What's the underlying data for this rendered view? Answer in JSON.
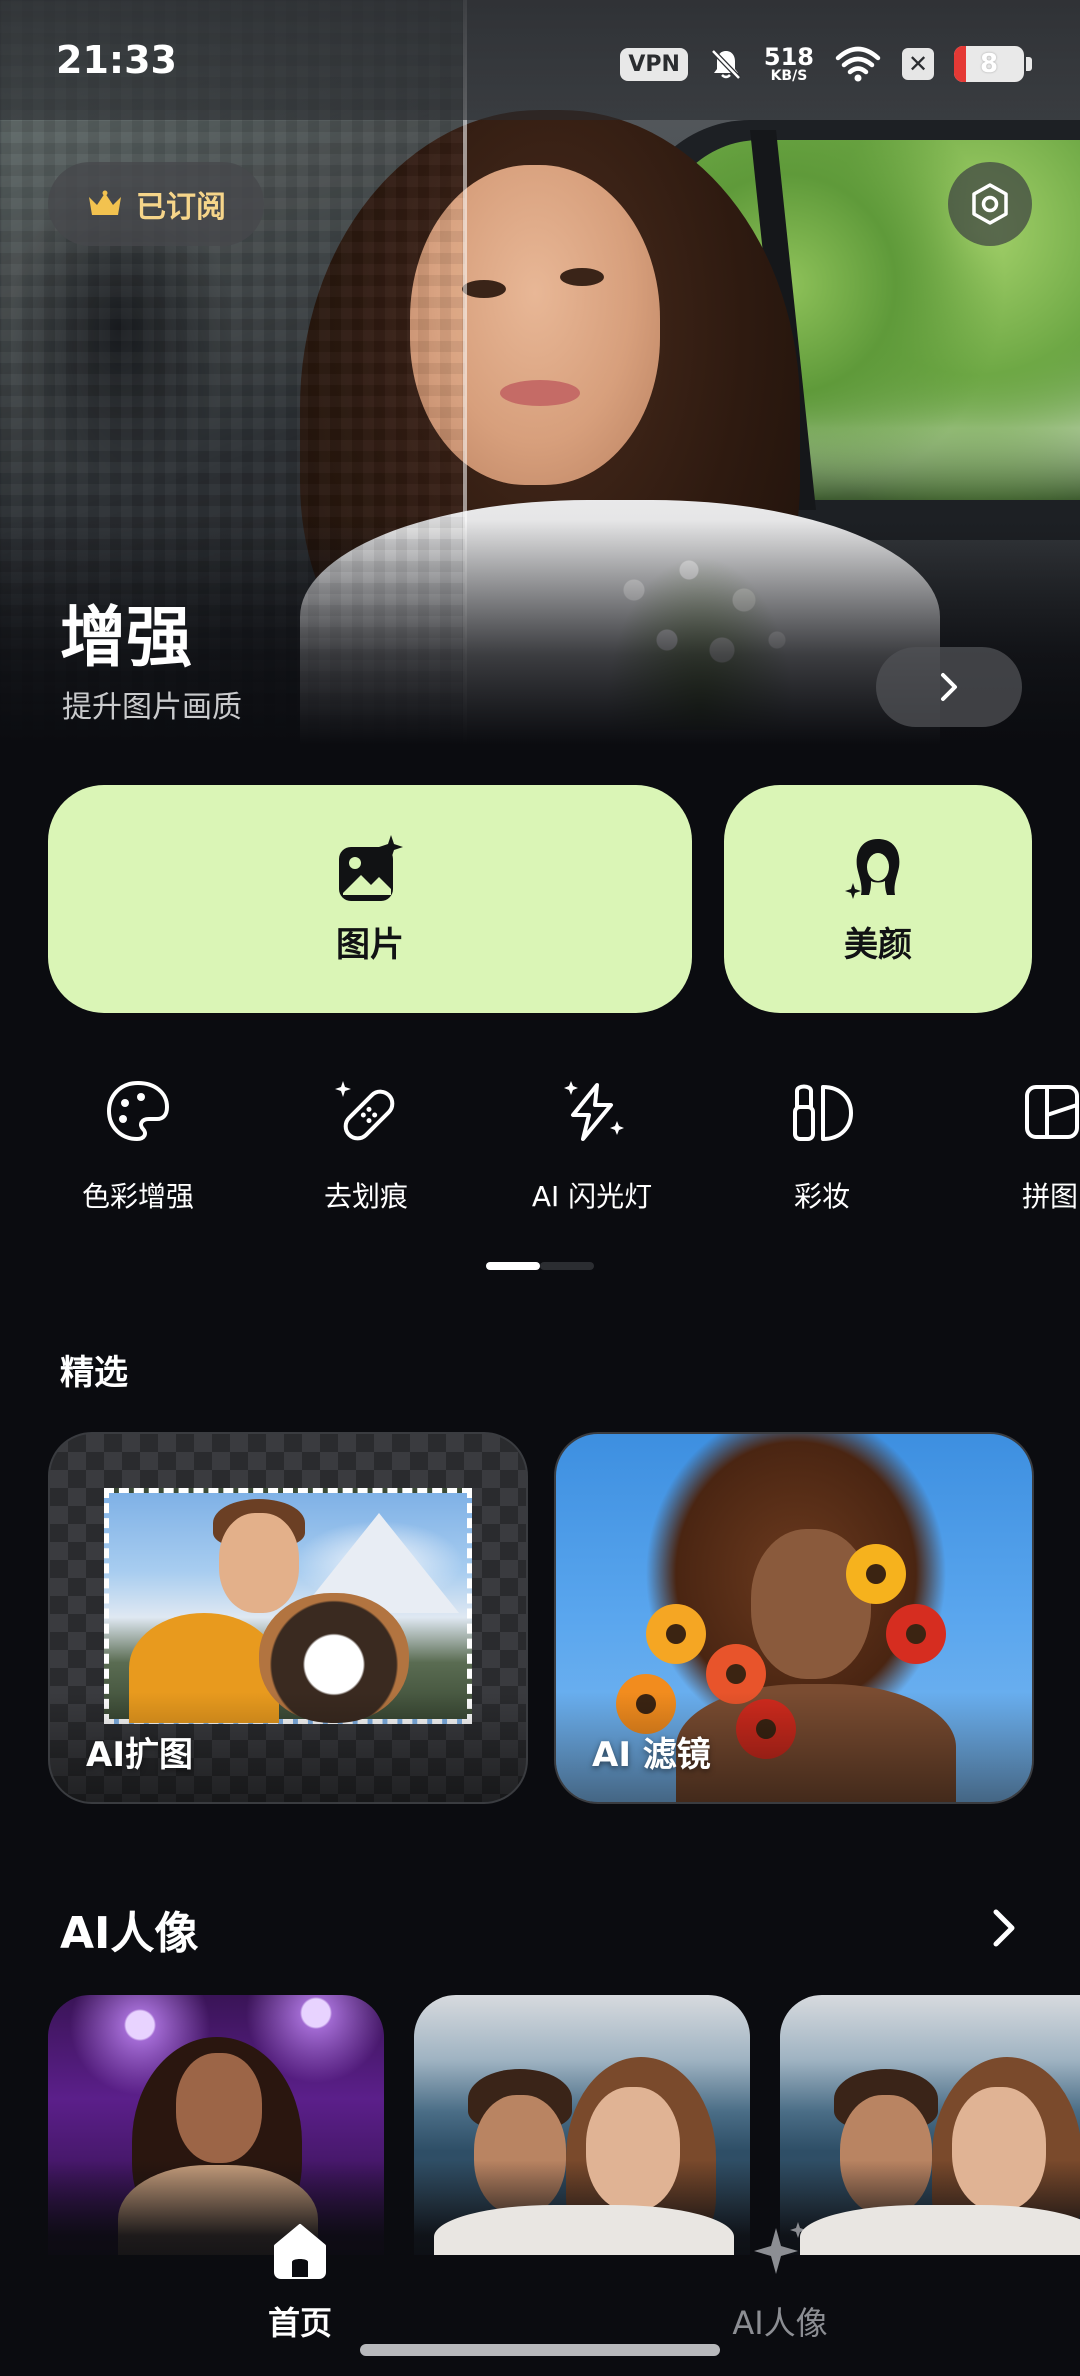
{
  "status_bar": {
    "time": "21:33",
    "vpn_label": "VPN",
    "net_speed": "518",
    "net_unit": "KB/S",
    "battery_level": "8",
    "battery_fraction": 0.08,
    "battery_color": "#e53935"
  },
  "hero": {
    "subscription_label": "已订阅",
    "title": "增强",
    "subtitle": "提升图片画质",
    "next_icon": "chevron-right-icon",
    "settings_icon": "settings-icon"
  },
  "actions": [
    {
      "label": "图片",
      "icon": "photo-sparkle-icon"
    },
    {
      "label": "美颜",
      "icon": "face-beauty-icon"
    }
  ],
  "tools": [
    {
      "label": "色彩增强",
      "icon": "palette-icon"
    },
    {
      "label": "去划痕",
      "icon": "bandage-icon"
    },
    {
      "label": "AI 闪光灯",
      "icon": "flash-sparkle-icon"
    },
    {
      "label": "彩妆",
      "icon": "makeup-icon"
    },
    {
      "label": "拼图",
      "icon": "collage-icon"
    }
  ],
  "featured": {
    "title": "精选",
    "cards": [
      {
        "label": "AI扩图"
      },
      {
        "label": "AI 滤镜"
      }
    ]
  },
  "ai_portrait": {
    "title": "AI人像"
  },
  "bottom_nav": [
    {
      "label": "首页",
      "icon": "home-icon",
      "active": true
    },
    {
      "label": "AI人像",
      "icon": "sparkle-icon",
      "active": false
    }
  ],
  "colors": {
    "accent_card": "#daf5b6",
    "background": "#0b0c10",
    "subscription_text": "#f6d58a"
  }
}
